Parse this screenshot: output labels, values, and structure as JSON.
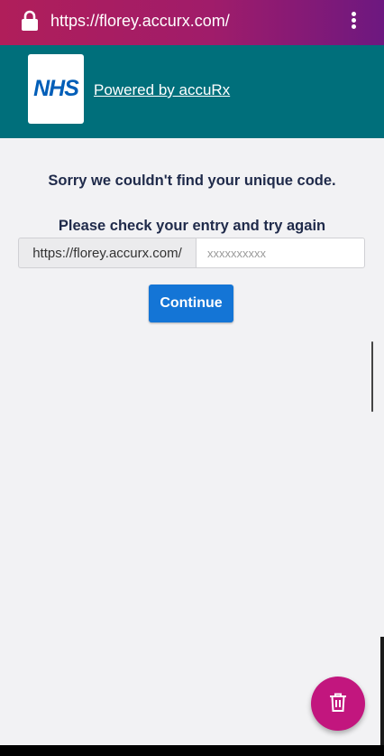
{
  "browser": {
    "url": "https://florey.accurx.com/"
  },
  "header": {
    "logo_text": "NHS",
    "powered_by": "Powered by accuRx"
  },
  "main": {
    "error_message": "Sorry we couldn't find your unique code.",
    "instruction": "Please check your entry and try again",
    "url_prefix": "https://florey.accurx.com/",
    "code_placeholder": "xxxxxxxxxx",
    "code_value": "",
    "continue_label": "Continue"
  },
  "fab": {
    "icon": "trash-icon"
  },
  "colors": {
    "header_bg": "#006f7b",
    "button_bg": "#1475d6",
    "fab_bg": "#c2167e",
    "text_dark": "#1f2a4a"
  }
}
